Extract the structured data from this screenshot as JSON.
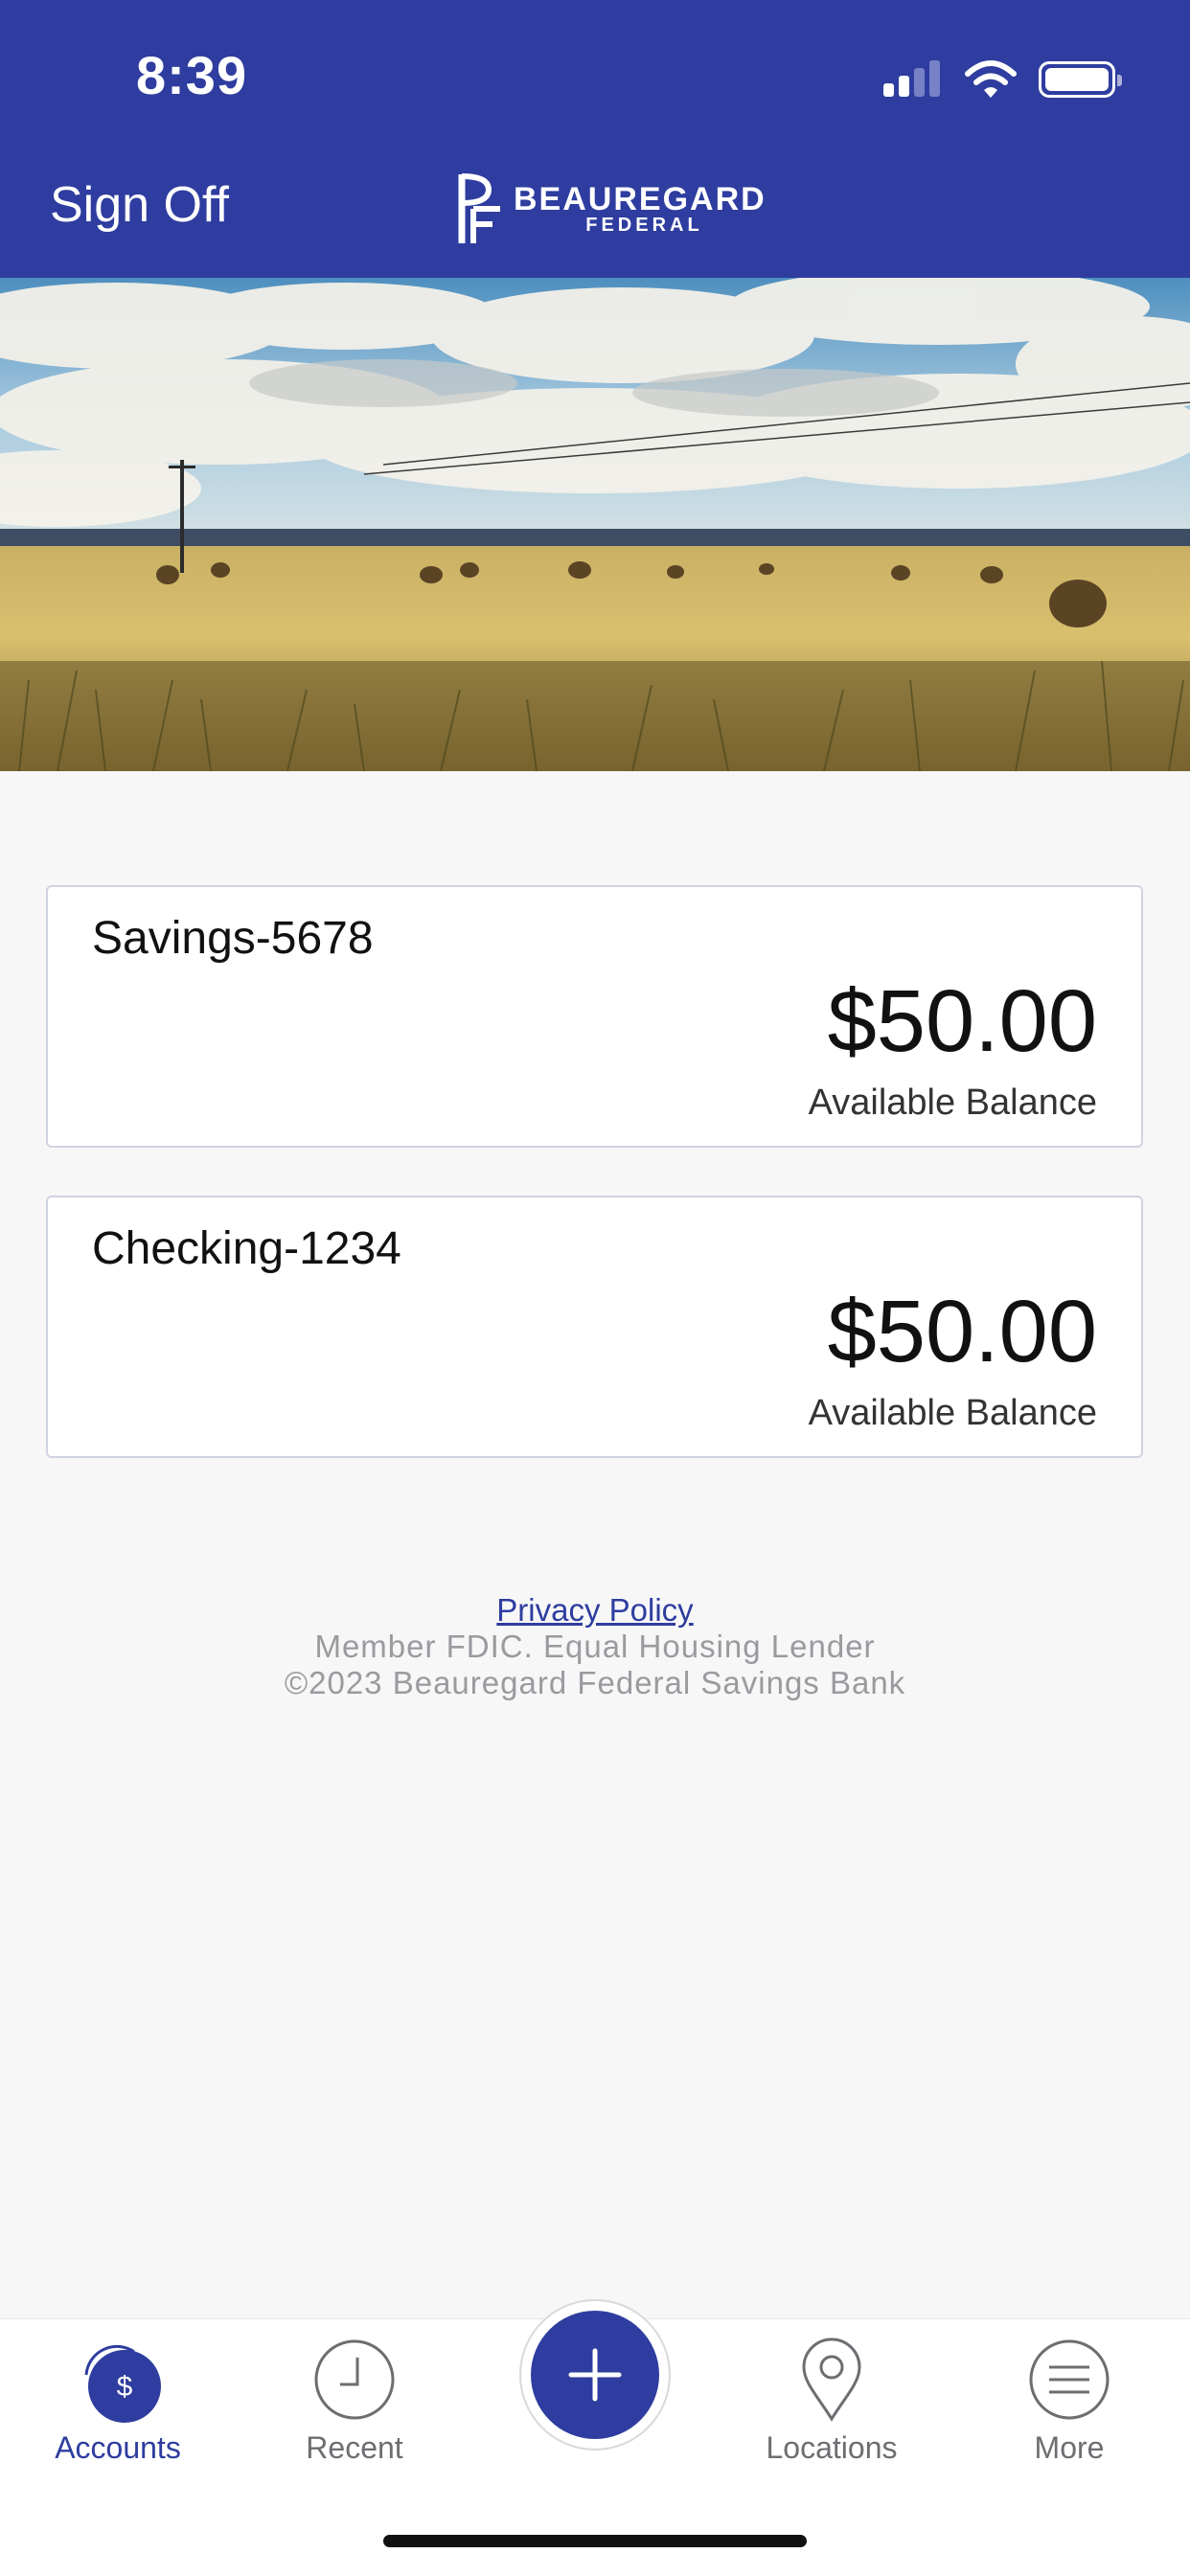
{
  "status_bar": {
    "time": "8:39"
  },
  "header": {
    "sign_off_label": "Sign Off",
    "logo_line1": "BEAUREGARD",
    "logo_line2": "FEDERAL",
    "logo_monogram": "BF"
  },
  "accounts": [
    {
      "name": "Savings-5678",
      "amount": "$50.00",
      "label": "Available Balance"
    },
    {
      "name": "Checking-1234",
      "amount": "$50.00",
      "label": "Available Balance"
    }
  ],
  "footer": {
    "privacy_link": "Privacy Policy",
    "line1": "Member FDIC. Equal Housing Lender",
    "line2": "©2023 Beauregard Federal Savings Bank"
  },
  "tabs": [
    {
      "label": "Accounts",
      "icon": "dollar-icon",
      "active": true
    },
    {
      "label": "Recent",
      "icon": "clock-icon",
      "active": false
    },
    {
      "label": "",
      "icon": "plus-icon",
      "active": false
    },
    {
      "label": "Locations",
      "icon": "location-pin-icon",
      "active": false
    },
    {
      "label": "More",
      "icon": "menu-icon",
      "active": false
    }
  ],
  "colors": {
    "brand": "#2e3d9f",
    "background": "#f7f7f8",
    "muted_text": "#9a9a9f"
  }
}
